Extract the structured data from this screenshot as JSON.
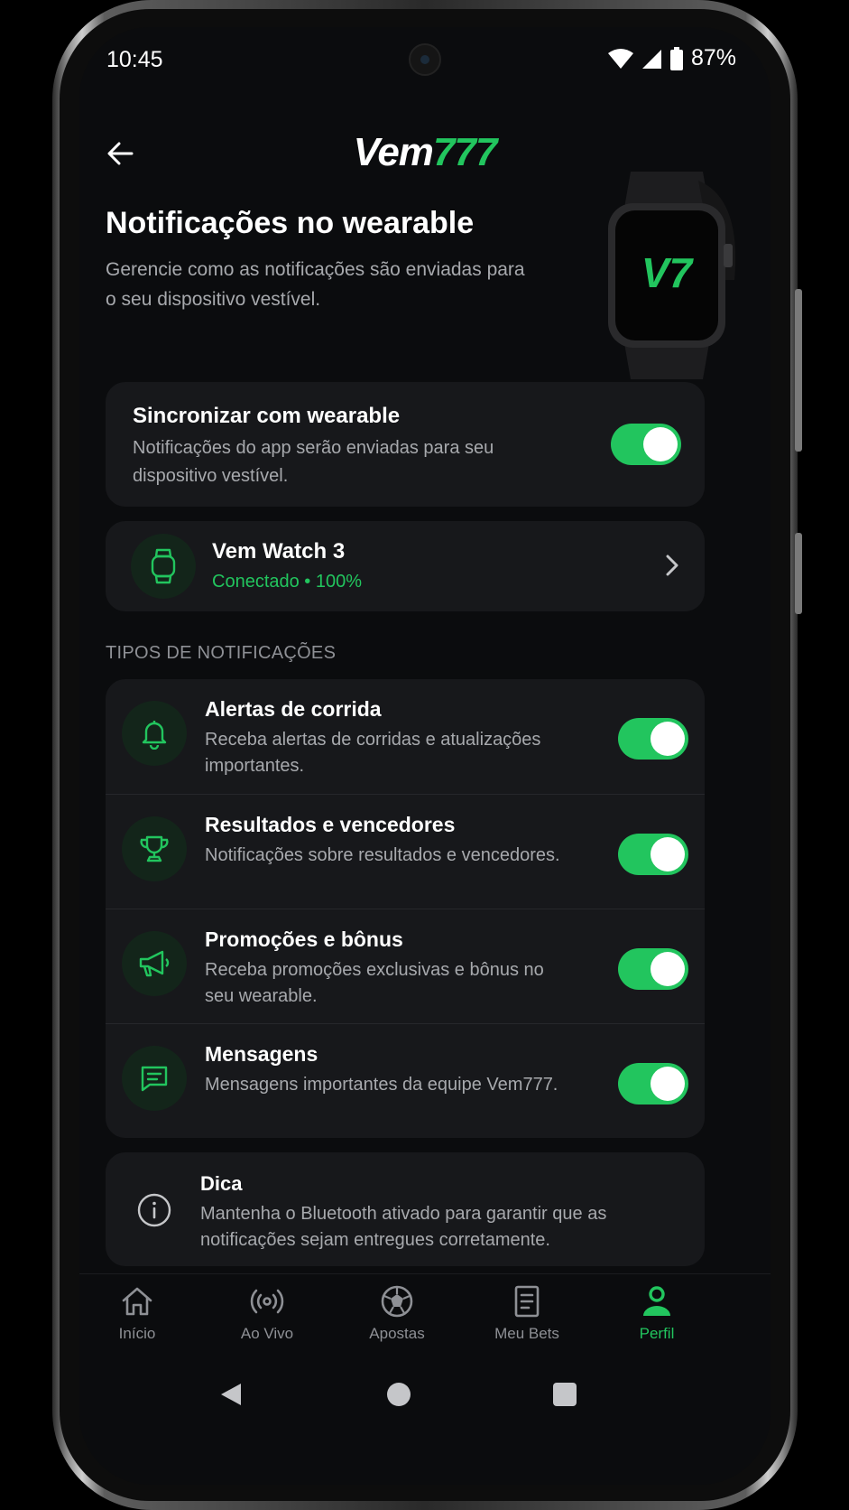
{
  "status_bar": {
    "time": "10:45",
    "battery": "87%"
  },
  "header": {
    "logo_white": "Vem",
    "logo_green": "777",
    "watch_logo": "V7"
  },
  "page": {
    "title": "Notificações no wearable",
    "subtitle": "Gerencie como as notificações são enviadas para o seu dispositivo vestível."
  },
  "sync": {
    "title": "Sincronizar com wearable",
    "description": "Notificações do app serão enviadas para seu dispositivo vestível.",
    "enabled": true
  },
  "device": {
    "name": "Vem Watch 3",
    "status": "Conectado • 100%",
    "icon": "watch-icon"
  },
  "section_label": "TIPOS DE NOTIFICAÇÕES",
  "notification_types": [
    {
      "title": "Alertas de corrida",
      "description": "Receba alertas de corridas e atualizações importantes.",
      "icon": "bell-icon",
      "enabled": true
    },
    {
      "title": "Resultados e vencedores",
      "description": "Notificações sobre resultados e vencedores.",
      "icon": "trophy-icon",
      "enabled": true
    },
    {
      "title": "Promoções e bônus",
      "description": "Receba promoções exclusivas e bônus no seu wearable.",
      "icon": "megaphone-icon",
      "enabled": true
    },
    {
      "title": "Mensagens",
      "description": "Mensagens importantes da equipe Vem777.",
      "icon": "message-icon",
      "enabled": true
    }
  ],
  "tip": {
    "title": "Dica",
    "description": "Mantenha o Bluetooth ativado para garantir que as notificações sejam entregues corretamente."
  },
  "bottom_nav": [
    {
      "label": "Início",
      "icon": "home-icon",
      "active": false
    },
    {
      "label": "Ao Vivo",
      "icon": "live-icon",
      "active": false
    },
    {
      "label": "Apostas",
      "icon": "soccer-ball-icon",
      "active": false
    },
    {
      "label": "Meu Bets",
      "icon": "document-icon",
      "active": false
    },
    {
      "label": "Perfil",
      "icon": "profile-icon",
      "active": true
    }
  ],
  "colors": {
    "accent": "#22c55e",
    "background": "#0b0c0e",
    "card": "#17181b",
    "muted_text": "#a7a9ad"
  }
}
